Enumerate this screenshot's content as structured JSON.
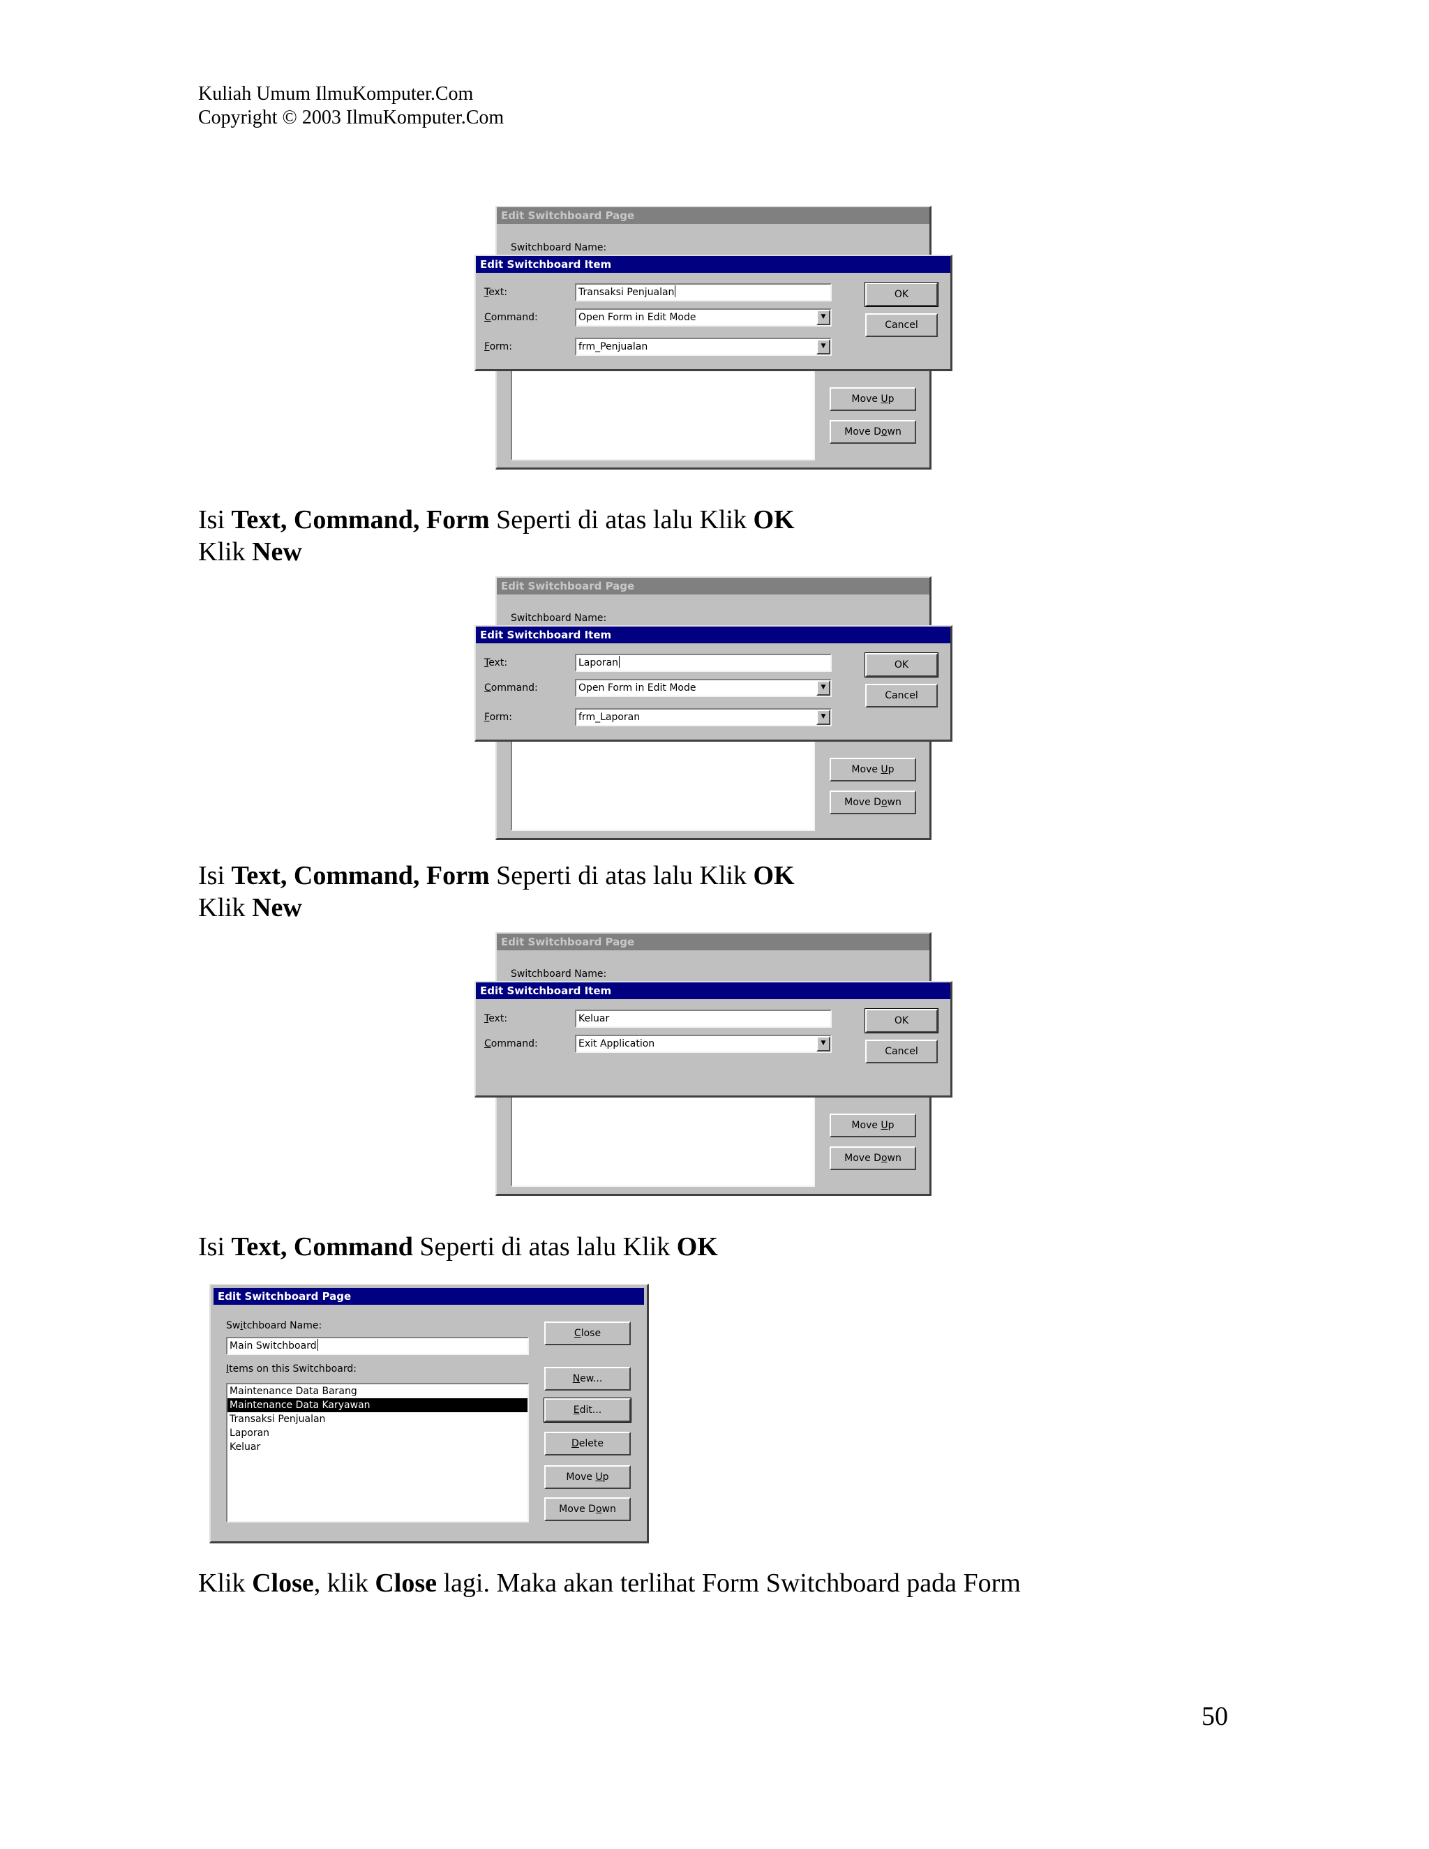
{
  "header": {
    "line1": "Kuliah Umum  IlmuKomputer.Com",
    "line2": "Copyright © 2003 IlmuKomputer.Com"
  },
  "page_number": "50",
  "common": {
    "back_title": "Edit Switchboard Page",
    "back_name_label": "Switchboard Name:",
    "item_title": "Edit Switchboard Item",
    "text_label": {
      "u": "T",
      "rest": "ext:"
    },
    "command_label": {
      "u": "C",
      "rest": "ommand:"
    },
    "form_label": {
      "u": "F",
      "rest": "orm:"
    },
    "ok": "OK",
    "cancel": "Cancel",
    "move_up": {
      "pre": "Move ",
      "u": "U",
      "post": "p"
    },
    "move_down": {
      "pre": "Move D",
      "u": "o",
      "post": "wn"
    },
    "dropdown_arrow": "▼"
  },
  "step1": {
    "text_value": "Transaksi Penjualan",
    "command_value": "Open Form in Edit Mode",
    "form_value": "frm_Penjualan"
  },
  "instruction1": {
    "a": "Isi ",
    "b": "Text, Command, Form",
    "c": " Seperti di atas lalu Klik ",
    "d": "OK"
  },
  "klik_new1": {
    "a": "Klik ",
    "b": "New"
  },
  "step2": {
    "text_value": "Laporan",
    "command_value": "Open Form in Edit Mode",
    "form_value": "frm_Laporan"
  },
  "instruction2": {
    "a": "Isi ",
    "b": "Text, Command, Form",
    "c": " Seperti di atas lalu Klik ",
    "d": "OK"
  },
  "klik_new2": {
    "a": "Klik ",
    "b": "New"
  },
  "step3": {
    "text_value": "Keluar",
    "command_value": "Exit Application"
  },
  "instruction3": {
    "a": "Isi ",
    "b": "Text, Command",
    "c": " Seperti di atas lalu Klik ",
    "d": "OK"
  },
  "final_dialog": {
    "title": "Edit Switchboard Page",
    "name_label": {
      "pre": "Sw",
      "u": "i",
      "post": "tchboard Name:"
    },
    "name_value": "Main Switchboard",
    "items_label": {
      "pre": "",
      "u": "I",
      "post": "tems on this Switchboard:"
    },
    "items": [
      "Maintenance Data Barang",
      "Maintenance Data Karyawan",
      "Transaksi Penjualan",
      "Laporan",
      "Keluar"
    ],
    "selected_index": 1,
    "close": {
      "pre": "",
      "u": "C",
      "post": "lose"
    },
    "new": {
      "pre": "",
      "u": "N",
      "post": "ew..."
    },
    "edit": {
      "pre": "",
      "u": "E",
      "post": "dit..."
    },
    "delete": {
      "pre": "",
      "u": "D",
      "post": "elete"
    },
    "move_up": {
      "pre": "Move ",
      "u": "U",
      "post": "p"
    },
    "move_down": {
      "pre": "Move D",
      "u": "o",
      "post": "wn"
    }
  },
  "final_text": {
    "a": "Klik ",
    "b": "Close",
    "c": ", klik ",
    "d": "Close",
    "e": " lagi. Maka akan terlihat Form Switchboard pada Form"
  }
}
